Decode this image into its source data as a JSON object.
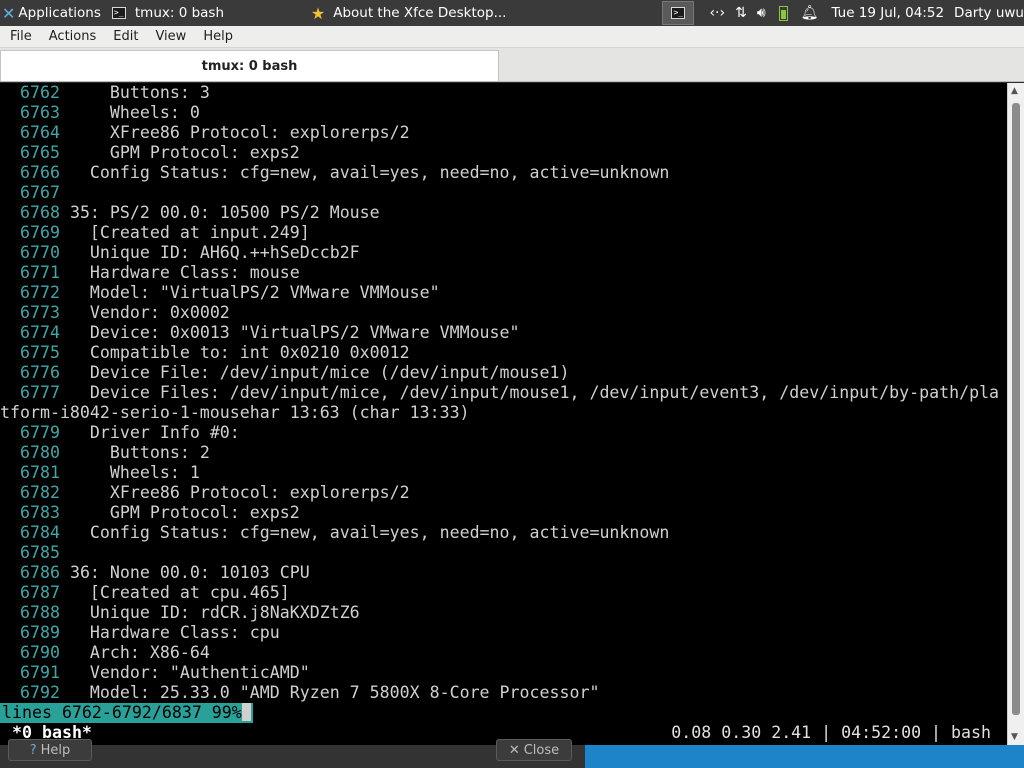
{
  "panel": {
    "applications_label": "Applications",
    "tasks": [
      {
        "label": "tmux: 0 bash",
        "icon": "terminal-icon",
        "active": false
      },
      {
        "label": "About the Xfce Desktop...",
        "icon": "star-icon",
        "active": false
      }
    ],
    "tray_terminal_glyph": ">_",
    "clock": "Tue 19 Jul, 04:52",
    "user": "Darty uwu"
  },
  "window": {
    "menu": [
      "File",
      "Actions",
      "Edit",
      "View",
      "Help"
    ],
    "tab_title": "tmux: 0 bash"
  },
  "terminal": {
    "lines": [
      {
        "n": "6762",
        "t": "    Buttons: 3"
      },
      {
        "n": "6763",
        "t": "    Wheels: 0"
      },
      {
        "n": "6764",
        "t": "    XFree86 Protocol: explorerps/2"
      },
      {
        "n": "6765",
        "t": "    GPM Protocol: exps2"
      },
      {
        "n": "6766",
        "t": "  Config Status: cfg=new, avail=yes, need=no, active=unknown"
      },
      {
        "n": "6767",
        "t": ""
      },
      {
        "n": "6768",
        "t": "35: PS/2 00.0: 10500 PS/2 Mouse"
      },
      {
        "n": "6769",
        "t": "  [Created at input.249]"
      },
      {
        "n": "6770",
        "t": "  Unique ID: AH6Q.++hSeDccb2F"
      },
      {
        "n": "6771",
        "t": "  Hardware Class: mouse"
      },
      {
        "n": "6772",
        "t": "  Model: \"VirtualPS/2 VMware VMMouse\""
      },
      {
        "n": "6773",
        "t": "  Vendor: 0x0002"
      },
      {
        "n": "6774",
        "t": "  Device: 0x0013 \"VirtualPS/2 VMware VMMouse\""
      },
      {
        "n": "6775",
        "t": "  Compatible to: int 0x0210 0x0012"
      },
      {
        "n": "6776",
        "t": "  Device File: /dev/input/mice (/dev/input/mouse1)"
      },
      {
        "n": "6777",
        "t": "  Device Files: /dev/input/mice, /dev/input/mouse1, /dev/input/event3, /dev/input/by-path/pla"
      },
      {
        "n": "",
        "t": "tform-i8042-serio-1-mousehar 13:63 (char 13:33)"
      },
      {
        "n": "6779",
        "t": "  Driver Info #0:"
      },
      {
        "n": "6780",
        "t": "    Buttons: 2"
      },
      {
        "n": "6781",
        "t": "    Wheels: 1"
      },
      {
        "n": "6782",
        "t": "    XFree86 Protocol: explorerps/2"
      },
      {
        "n": "6783",
        "t": "    GPM Protocol: exps2"
      },
      {
        "n": "6784",
        "t": "  Config Status: cfg=new, avail=yes, need=no, active=unknown"
      },
      {
        "n": "6785",
        "t": ""
      },
      {
        "n": "6786",
        "t": "36: None 00.0: 10103 CPU"
      },
      {
        "n": "6787",
        "t": "  [Created at cpu.465]"
      },
      {
        "n": "6788",
        "t": "  Unique ID: rdCR.j8NaKXDZtZ6"
      },
      {
        "n": "6789",
        "t": "  Hardware Class: cpu"
      },
      {
        "n": "6790",
        "t": "  Arch: X86-64"
      },
      {
        "n": "6791",
        "t": "  Vendor: \"AuthenticAMD\""
      },
      {
        "n": "6792",
        "t": "  Model: 25.33.0 \"AMD Ryzen 7 5800X 8-Core Processor\""
      }
    ],
    "pager_status": "lines 6762-6792/6837 99%",
    "tmux_left": "*0 bash*",
    "tmux_right": "0.08 0.30 2.41 | 04:52:00 | bash"
  },
  "background": {
    "help_label": "Help",
    "close_label": "Close"
  }
}
